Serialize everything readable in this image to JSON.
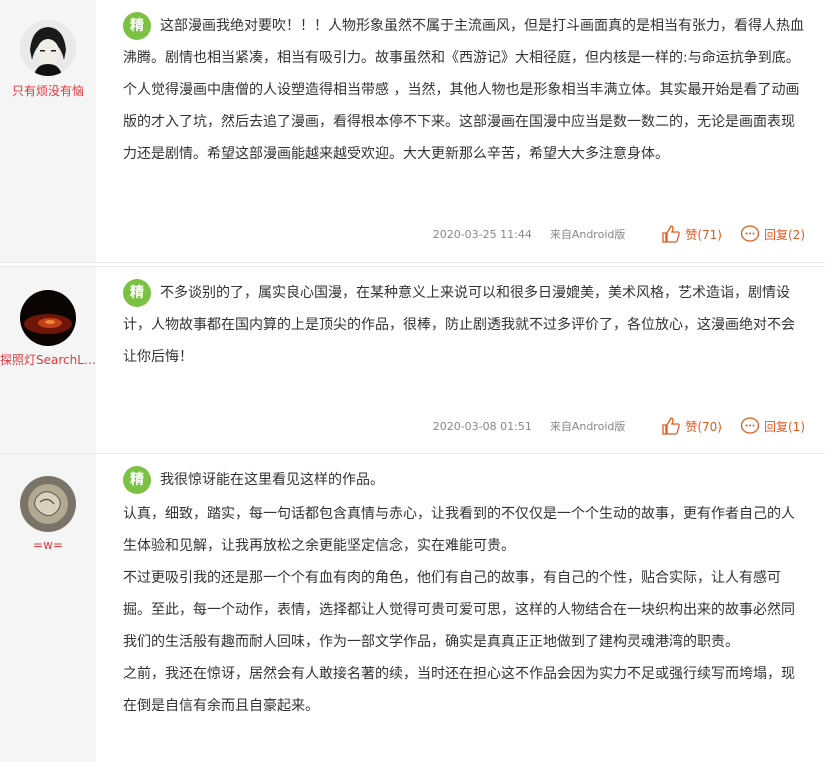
{
  "comments": [
    {
      "username": "只有烦没有恼",
      "badge": "精",
      "paragraphs": [
        "这部漫画我绝对要吹！！！人物形象虽然不属于主流画风，但是打斗画面真的是相当有张力，看得人热血沸腾。剧情也相当紧凑，相当有吸引力。故事虽然和《西游记》大相径庭，但内核是一样的:与命运抗争到底。个人觉得漫画中唐僧的人设塑造得相当带感 ，当然，其他人物也是形象相当丰满立体。其实最开始是看了动画版的才入了坑，然后去追了漫画，看得根本停不下来。这部漫画在国漫中应当是数一数二的，无论是画面表现力还是剧情。希望这部漫画能越来越受欢迎。大大更新那么辛苦，希望大大多注意身体。"
      ],
      "time": "2020-03-25 11:44",
      "source": "来自Android版",
      "like_label": "赞(71)",
      "reply_label": "回复(2)"
    },
    {
      "username": "探照灯SearchLi…",
      "badge": "精",
      "paragraphs": [
        "不多谈别的了，属实良心国漫，在某种意义上来说可以和很多日漫媲美，美术风格，艺术造诣，剧情设计，人物故事都在国内算的上是顶尖的作品，很棒，防止剧透我就不过多评价了，各位放心，这漫画绝对不会让你后悔！"
      ],
      "time": "2020-03-08 01:51",
      "source": "来自Android版",
      "like_label": "赞(70)",
      "reply_label": "回复(1)"
    },
    {
      "username": "=w=",
      "badge": "精",
      "paragraphs": [
        "我很惊讶能在这里看见这样的作品。",
        "认真，细致，踏实，每一句话都包含真情与赤心，让我看到的不仅仅是一个个生动的故事，更有作者自己的人生体验和见解，让我再放松之余更能坚定信念，实在难能可贵。",
        "不过更吸引我的还是那一个个有血有肉的角色，他们有自己的故事，有自己的个性，贴合实际，让人有感可掘。至此，每一个动作，表情，选择都让人觉得可贵可爱可思，这样的人物结合在一块织构出来的故事必然同我们的生活般有趣而耐人回味，作为一部文学作品，确实是真真正正地做到了建构灵魂港湾的职责。",
        "之前，我还在惊讶，居然会有人敢接名著的续，当时还在担心这不作品会因为实力不足或强行续写而垮塌，现在倒是自信有余而且自豪起来。"
      ]
    }
  ],
  "colors": {
    "badge": "#7bc142",
    "username": "#e0393e",
    "action": "#e05a1e"
  }
}
